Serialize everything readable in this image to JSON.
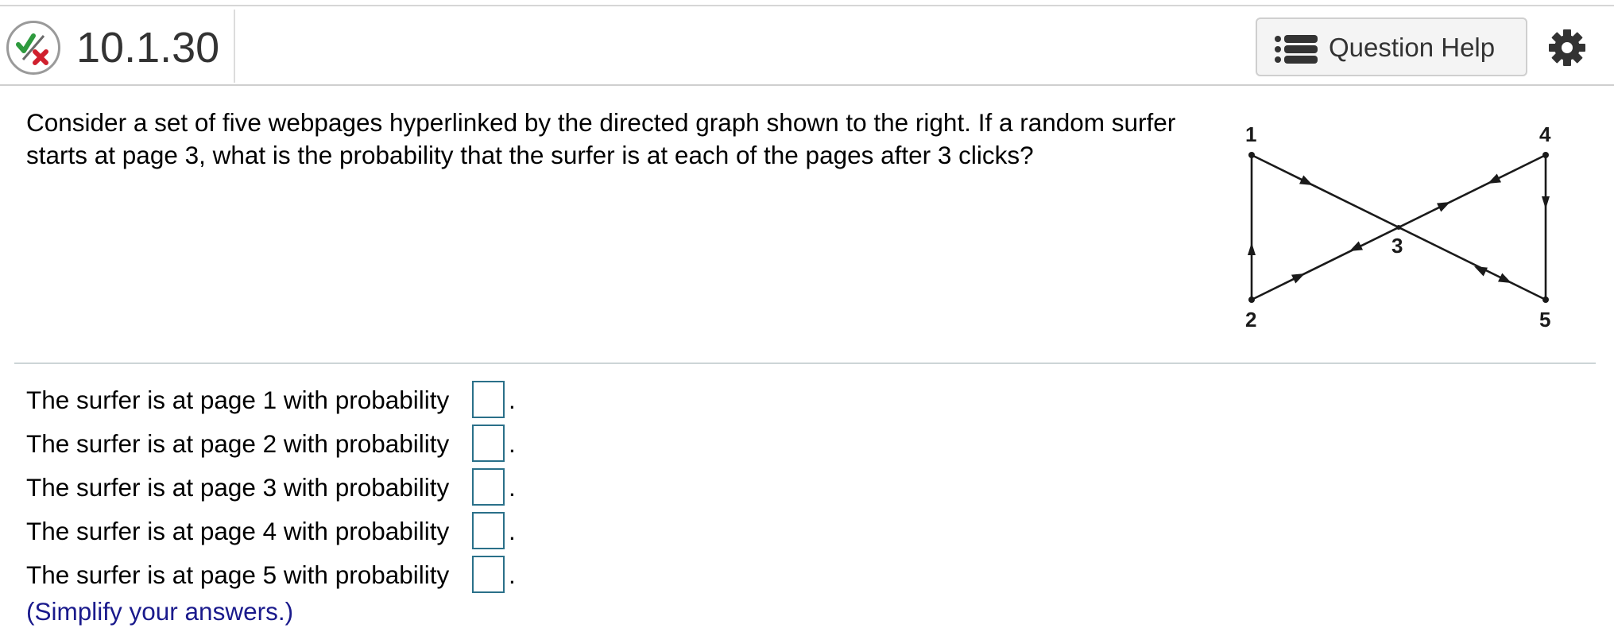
{
  "header": {
    "question_number": "10.1.30",
    "help_label": "Question Help",
    "status_icon": "partially-correct-icon",
    "settings_icon": "gear-icon"
  },
  "question": {
    "text": "Consider a set of five webpages hyperlinked by the directed graph shown to the right. If a random surfer starts at page 3, what is the probability that the surfer is at each of the pages after 3 clicks?"
  },
  "graph": {
    "nodes": [
      {
        "id": "1",
        "label": "1"
      },
      {
        "id": "2",
        "label": "2"
      },
      {
        "id": "3",
        "label": "3"
      },
      {
        "id": "4",
        "label": "4"
      },
      {
        "id": "5",
        "label": "5"
      }
    ],
    "edges": [
      {
        "from": "1",
        "to": "3"
      },
      {
        "from": "3",
        "to": "5"
      },
      {
        "from": "5",
        "to": "3"
      },
      {
        "from": "3",
        "to": "2"
      },
      {
        "from": "2",
        "to": "3"
      },
      {
        "from": "3",
        "to": "4"
      },
      {
        "from": "4",
        "to": "3"
      },
      {
        "from": "2",
        "to": "1"
      },
      {
        "from": "4",
        "to": "5"
      }
    ]
  },
  "answers": [
    {
      "prefix": "The surfer is at page 1 with probability",
      "value": "",
      "suffix": "."
    },
    {
      "prefix": "The surfer is at page 2 with probability",
      "value": "",
      "suffix": "."
    },
    {
      "prefix": "The surfer is at page 3 with probability",
      "value": "",
      "suffix": "."
    },
    {
      "prefix": "The surfer is at page 4 with probability",
      "value": "",
      "suffix": "."
    },
    {
      "prefix": "The surfer is at page 5 with probability",
      "value": "",
      "suffix": "."
    }
  ],
  "hint": "(Simplify your answers.)",
  "colors": {
    "check": "#2e9a3e",
    "cross": "#d0202e",
    "input_border": "#2a7089",
    "hint_text": "#1a1a8c"
  }
}
